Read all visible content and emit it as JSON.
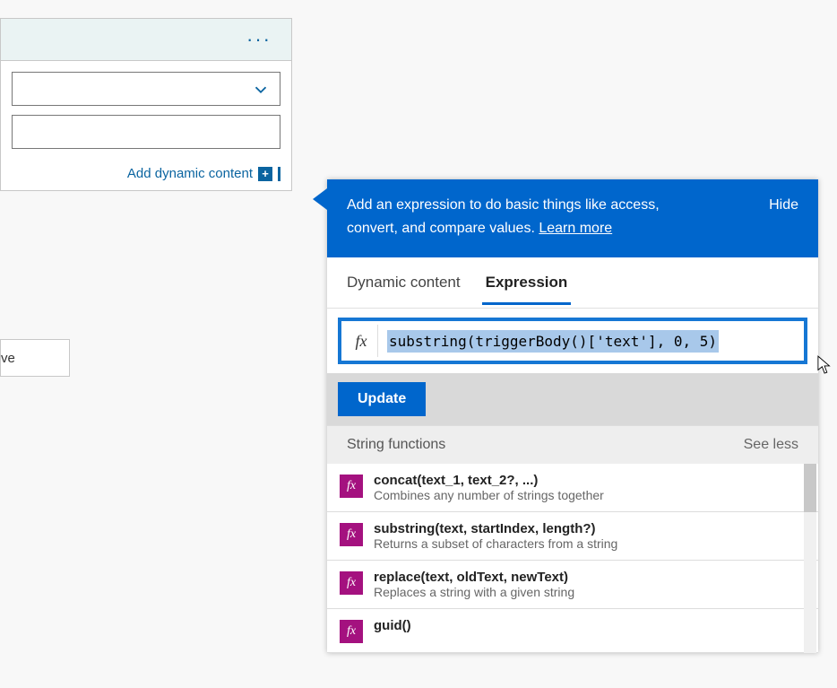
{
  "step": {
    "ellipsis": "···",
    "add_dynamic_label": "Add dynamic content",
    "plus_glyph": "+"
  },
  "fragment": {
    "label": "ve"
  },
  "panel": {
    "banner_text_line1": "Add an expression to do basic things like access,",
    "banner_text_line2": "convert, and compare values. ",
    "learn_more": "Learn more",
    "hide": "Hide",
    "tabs": {
      "dynamic": "Dynamic content",
      "expression": "Expression"
    },
    "fx_label": "fx",
    "expression_value": "substring(triggerBody()['text'], 0, 5)",
    "update_label": "Update",
    "section": {
      "title": "String functions",
      "see_less": "See less"
    },
    "functions": [
      {
        "sig": "concat(text_1, text_2?, ...)",
        "desc": "Combines any number of strings together"
      },
      {
        "sig": "substring(text, startIndex, length?)",
        "desc": "Returns a subset of characters from a string"
      },
      {
        "sig": "replace(text, oldText, newText)",
        "desc": "Replaces a string with a given string"
      },
      {
        "sig": "guid()",
        "desc": ""
      }
    ]
  }
}
